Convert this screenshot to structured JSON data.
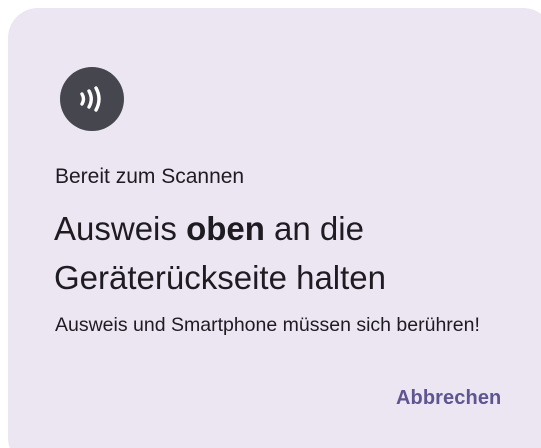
{
  "dialog": {
    "icon": "nfc-contactless-icon",
    "status_label": "Bereit zum Scannen",
    "headline": {
      "before": "Ausweis ",
      "emphasis": "oben",
      "after": " an die Geräterückseite halten"
    },
    "hint": "Ausweis und Smartphone müssen sich berühren!",
    "cancel_label": "Abbrechen"
  },
  "colors": {
    "sheet_background": "#ece6f2",
    "icon_background": "#46464e",
    "icon_foreground": "#ffffff",
    "text": "#1e1b22",
    "accent": "#5f5590"
  }
}
